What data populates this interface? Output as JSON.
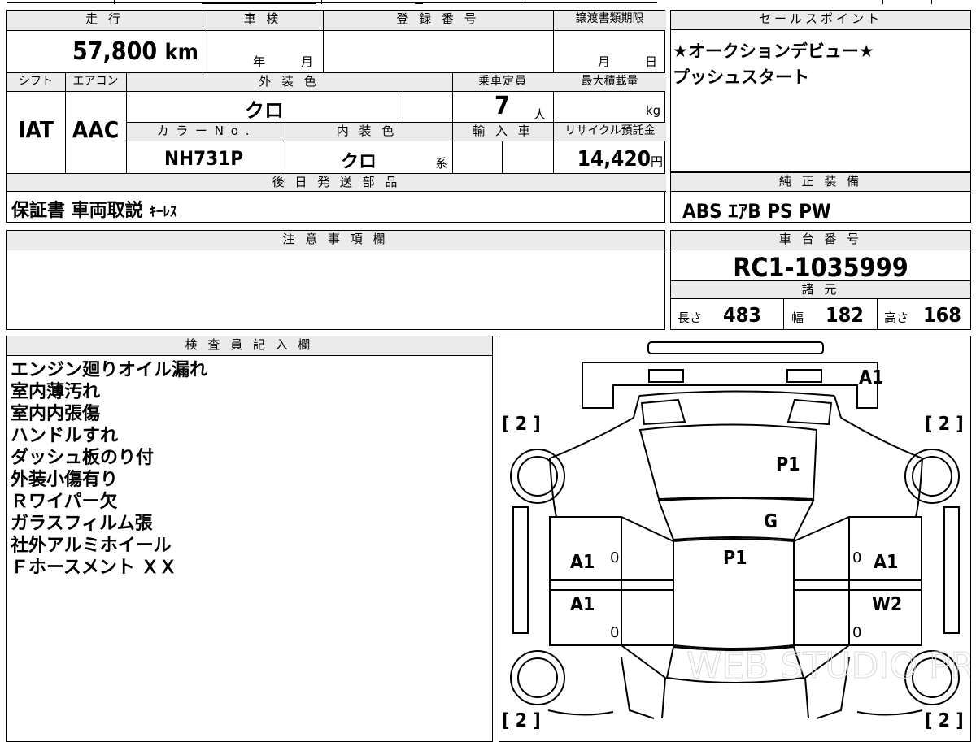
{
  "basic": {
    "mileage_label": "走 行",
    "mileage_value": "57,800",
    "mileage_unit": "km",
    "shaken_label": "車 検",
    "shaken_year_unit": "年",
    "shaken_month_unit": "月",
    "registration_label": "登 録 番 号",
    "transfer_deadline_label": "譲渡書類期限",
    "transfer_month_unit": "月",
    "transfer_day_unit": "日",
    "shift_label": "シフト",
    "shift_value": "IAT",
    "aircon_label": "エアコン",
    "aircon_value": "AAC",
    "exterior_color_label": "外 装 色",
    "exterior_color_value": "クロ",
    "capacity_label": "乗車定員",
    "capacity_value": "7",
    "capacity_unit": "人",
    "max_load_label": "最大積載量",
    "max_load_unit": "kg",
    "color_no_label": "カ ラ ー N o .",
    "color_no_value": "NH731P",
    "interior_color_label": "内 装 色",
    "interior_color_value": "クロ",
    "interior_color_suffix": "系",
    "import_label": "輸 入 車",
    "recycle_label": "リサイクル預託金",
    "recycle_value": "14,420",
    "recycle_unit": "円"
  },
  "later_parts": {
    "label": "後 日 発 送 部 品",
    "value_main": "保証書 車両取説",
    "value_small": "ｷｰﾚｽ"
  },
  "sales_point": {
    "label": "セールスポイント",
    "lines": [
      "★オークションデビュー★",
      "プッシュスタート"
    ]
  },
  "standard_equipment": {
    "label": "純 正 装 備",
    "value": "ABS ｴｱB PS PW"
  },
  "notes": {
    "label": "注 意 事 項 欄"
  },
  "chassis": {
    "label": "車 台 番 号",
    "value": "RC1-1035999"
  },
  "specs": {
    "label": "諸 元",
    "length_label": "長さ",
    "length_value": "483",
    "width_label": "幅",
    "width_value": "182",
    "height_label": "高さ",
    "height_value": "168"
  },
  "inspector": {
    "label": "検 査 員 記 入 欄",
    "lines": [
      "エンジン廻りオイル漏れ",
      "室内薄汚れ",
      "室内内張傷",
      "ハンドルすれ",
      "ダッシュ板のり付",
      "外装小傷有り",
      "Ｒワイパー欠",
      "ガラスフィルム張",
      "社外アルミホイール",
      "Ｆホースメント ＸＸ"
    ]
  },
  "diagram": {
    "marks": {
      "front_top": "A1",
      "hood": "P1",
      "windshield": "G",
      "roof": "P1",
      "left_front_door": "A1",
      "left_rear_door": "A1",
      "right_front_door": "A1",
      "right_rear_door": "W2",
      "tire_front_left": "[ 2 ]",
      "tire_front_right": "[ 2 ]",
      "tire_rear_left": "[ 2 ]",
      "tire_rear_right": "[ 2 ]",
      "zero": "0"
    },
    "watermark": "WEB STUDIO PRO"
  }
}
